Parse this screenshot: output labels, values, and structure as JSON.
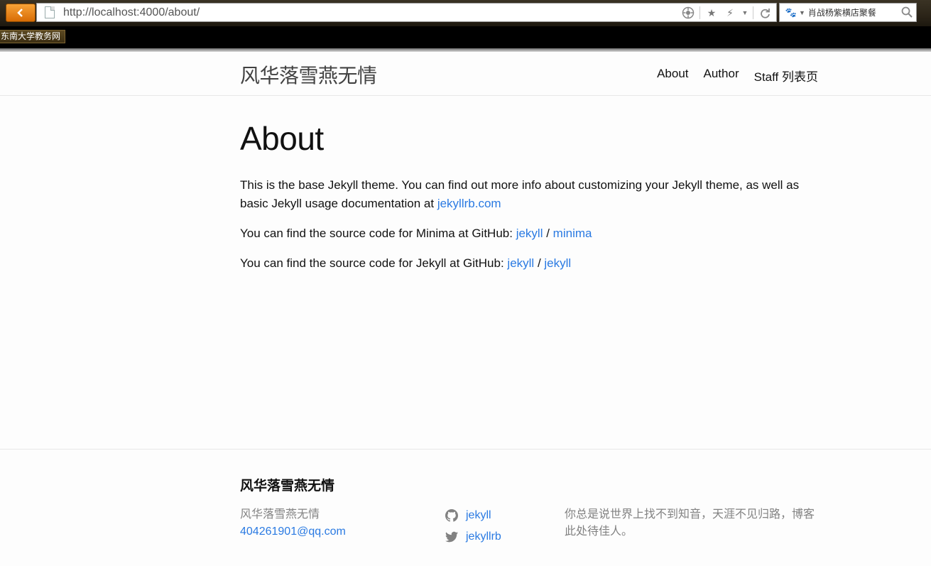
{
  "browser": {
    "url": "http://localhost:4000/about/",
    "search_query": "肖战杨紫横店聚餐",
    "bookmark": "东南大学教务网"
  },
  "site": {
    "title": "风华落雪燕无情",
    "nav": [
      "About",
      "Author",
      "Staff 列表页"
    ]
  },
  "page": {
    "heading": "About",
    "p1_text": "This is the base Jekyll theme. You can find out more info about customizing your Jekyll theme, as well as basic Jekyll usage documentation at ",
    "p1_link": "jekyllrb.com",
    "p2_text": "You can find the source code for Minima at GitHub: ",
    "p2_link1": "jekyll",
    "p2_sep": " / ",
    "p2_link2": "minima",
    "p3_text": "You can find the source code for Jekyll at GitHub: ",
    "p3_link1": "jekyll",
    "p3_sep": " / ",
    "p3_link2": "jekyll"
  },
  "footer": {
    "heading": "风华落雪燕无情",
    "name": "风华落雪燕无情",
    "email": "404261901@qq.com",
    "github": "jekyll",
    "twitter": "jekyllrb",
    "description": "你总是说世界上找不到知音，天涯不见归路，博客此处待佳人。"
  },
  "colors": {
    "link": "#2a7ae2",
    "text": "#111111",
    "muted": "#828282",
    "back_button": "#f08a1e"
  }
}
